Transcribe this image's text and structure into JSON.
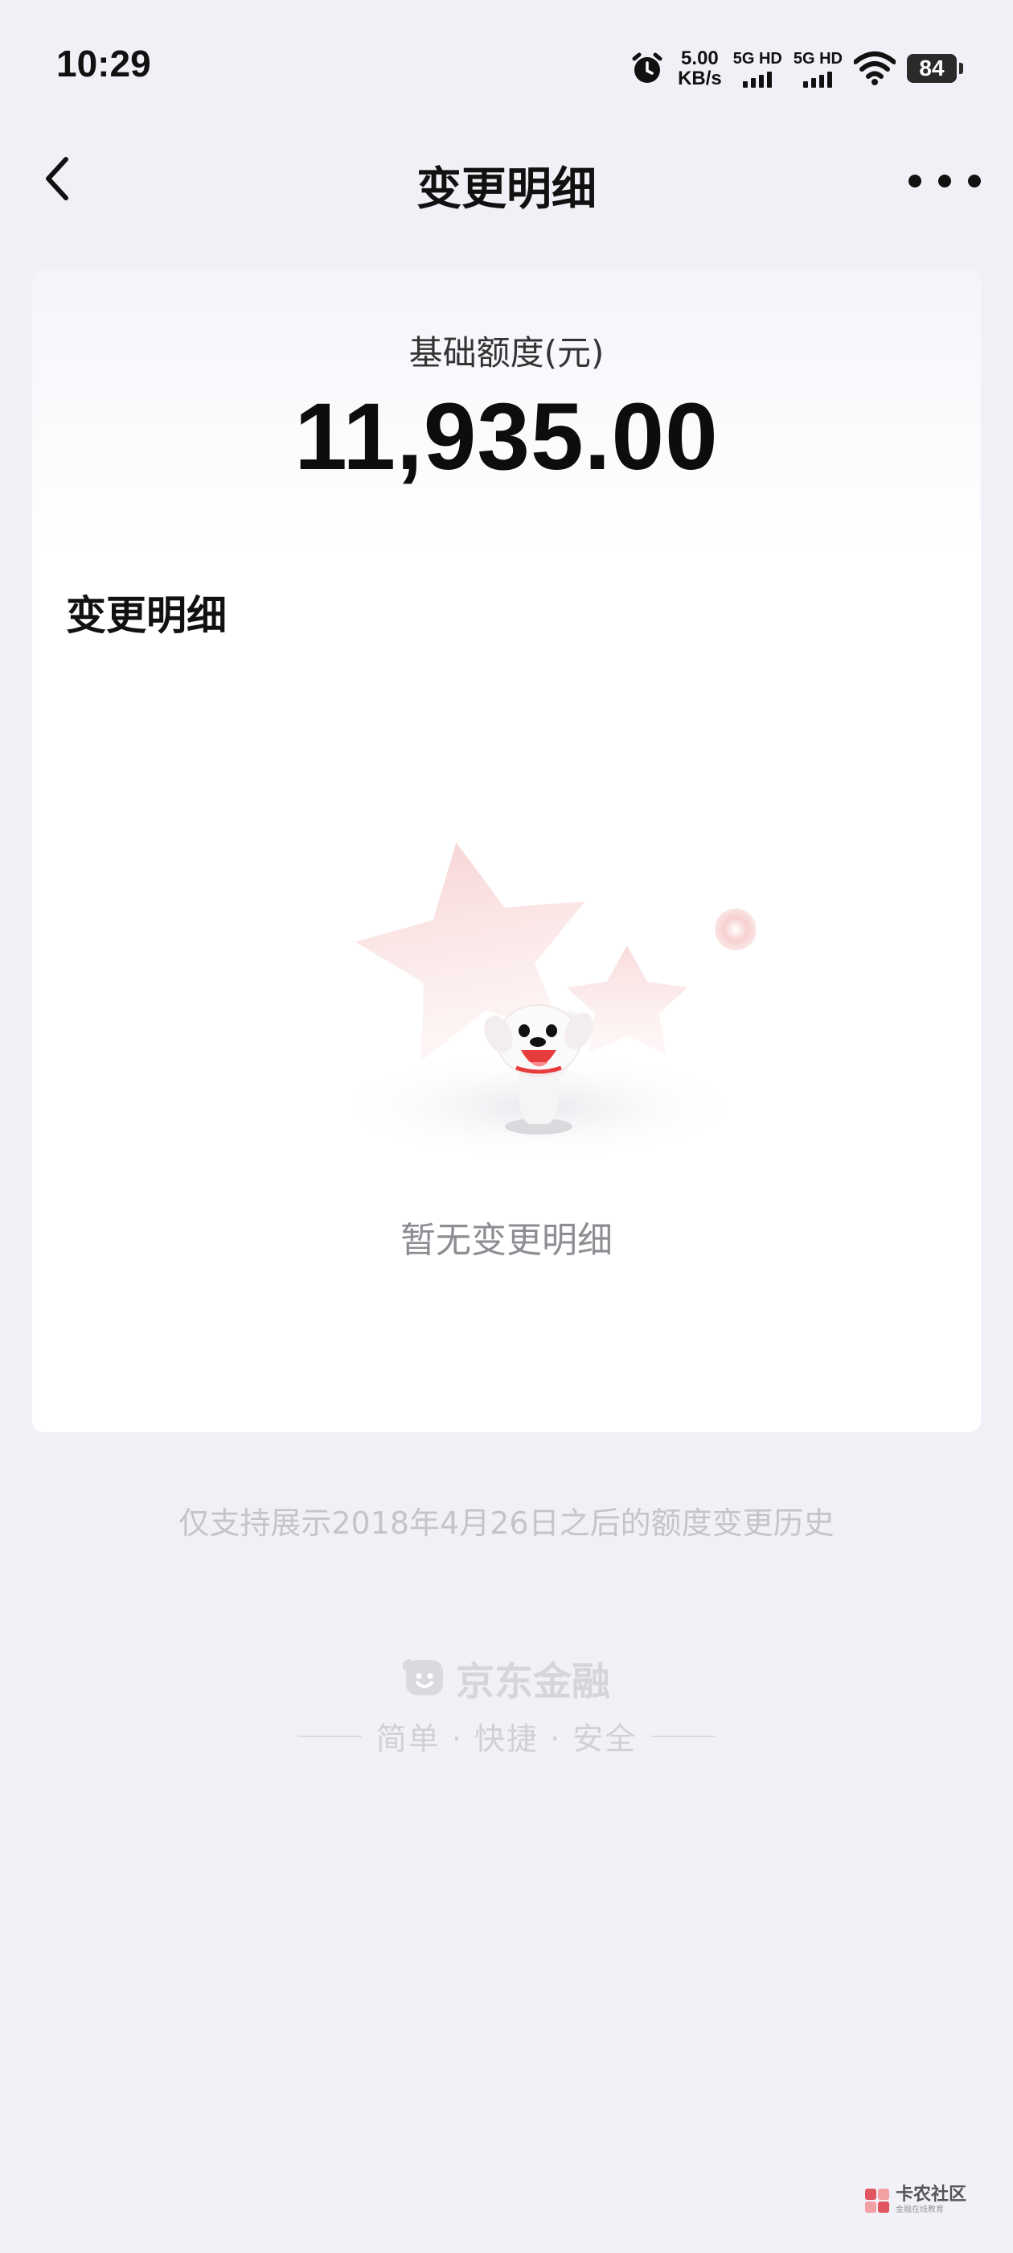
{
  "status_bar": {
    "time": "10:29",
    "net_speed_value": "5.00",
    "net_speed_unit": "KB/s",
    "sim1_label": "5G HD",
    "sim2_label": "5G HD",
    "battery": "84",
    "icons": [
      "alarm-icon",
      "signal-icon",
      "wifi-icon",
      "battery-icon"
    ]
  },
  "header": {
    "title": "变更明细",
    "back_icon": "chevron-left-icon",
    "more_icon": "more-horizontal-icon"
  },
  "card": {
    "limit_label": "基础额度(元)",
    "limit_value": "11,935.00",
    "section_title": "变更明细",
    "empty_text": "暂无变更明细"
  },
  "history_note": "仅支持展示2018年4月26日之后的额度变更历史",
  "brand": {
    "name": "京东金融",
    "slogan": "简单 · 快捷 · 安全",
    "logo_icon": "jd-dog-logo-icon"
  },
  "watermark": {
    "name": "卡农社区",
    "sub": "金融在线教育"
  },
  "colors": {
    "page_bg": "#f2f1f7",
    "card_bg": "#ffffff",
    "text_primary": "#111111",
    "text_muted": "#8d8d93",
    "note_text": "#c4c4ca",
    "illustration_pink": "#f7d9d9"
  }
}
